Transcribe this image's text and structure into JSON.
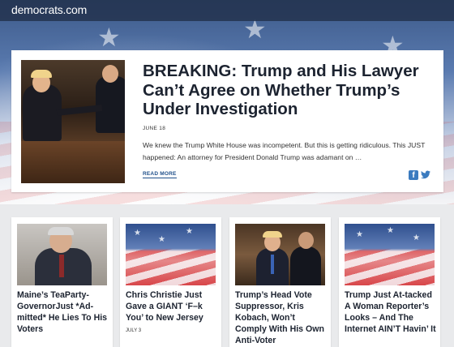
{
  "site": {
    "logo": "democrats.com"
  },
  "featured": {
    "title": "BREAKING: Trump and His Lawyer Can’t Agree on Whether Trump’s Under Investigation",
    "date": "JUNE 18",
    "excerpt": "We knew the Trump White House was incompetent. But this is getting ridiculous. This JUST happened: An attorney for President Donald Trump was adamant on …",
    "read_more": "READ MORE",
    "share_icons": [
      "facebook-icon",
      "twitter-icon"
    ]
  },
  "cards": [
    {
      "title": "Maine’s TeaParty-GovernorJust *Ad-mitted* He Lies To His Voters",
      "date": "",
      "image": "portrait-photo"
    },
    {
      "title": "Chris Christie Just Gave a GIANT ‘F–k You’ to New Jersey",
      "date": "JULY 3",
      "image": "flag-image"
    },
    {
      "title": "Trump’s Head Vote Suppressor, Kris Kobach, Won’t Comply With His Own Anti-Voter",
      "date": "",
      "image": "two-men-photo"
    },
    {
      "title": "Trump Just At-tacked A Woman Reporter’s Looks – And The Internet AIN’T Havin’ It",
      "date": "",
      "image": "flag-image"
    }
  ],
  "colors": {
    "accent": "#1f4f8a",
    "title": "#1c2330",
    "page_bg": "#e9eaec",
    "social": "#3b7bbf"
  }
}
